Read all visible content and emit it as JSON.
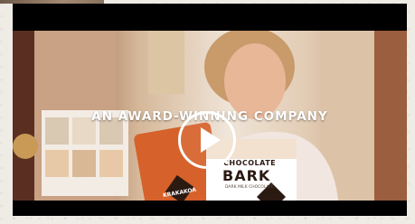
{
  "video": {
    "caption": "AN AWARD-WINNING COMPANY",
    "brand_label": "KRAKAKOA",
    "product_line1": "CHOCOLATE",
    "product_line2": "BARK",
    "product_subtext": "DARK MILK CHOCOLATE"
  },
  "icons": [
    "play-icon"
  ],
  "colors": {
    "letterbox": "#000000",
    "play_button": "#ffffff",
    "orange_package": "#d6612a"
  }
}
